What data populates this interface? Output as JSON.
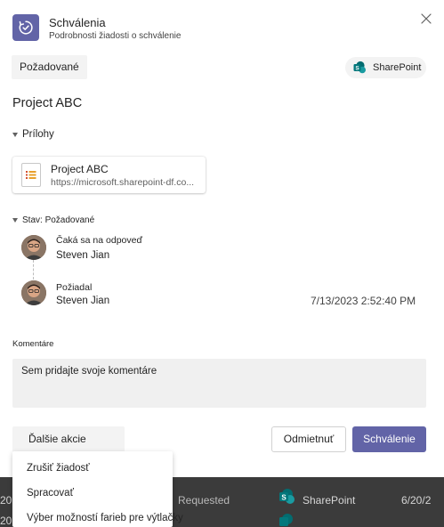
{
  "background": {
    "row1_left": "20",
    "row1_status": "Requested",
    "row1_source": "SharePoint",
    "row1_date": "6/20/2",
    "row2_left": "20"
  },
  "header": {
    "title": "Schválenia",
    "subtitle": "Podrobnosti žiadosti o schválenie",
    "app_icon": "approvals-icon",
    "close_icon": "close-icon"
  },
  "status_pill": "Požadované",
  "source_pill": "SharePoint",
  "project_title": "Project ABC",
  "attachments": {
    "section_label": "Prílohy",
    "item": {
      "name": "Project ABC",
      "url": "https://microsoft.sharepoint-df.co..."
    }
  },
  "status_section": {
    "label": "Stav: Požadované",
    "entries": [
      {
        "status": "Čaká sa na odpoveď",
        "name": "Steven Jian",
        "date": ""
      },
      {
        "status": "Požiadal",
        "name": "Steven Jian",
        "date": "7/13/2023 2:52:40 PM"
      }
    ]
  },
  "comments": {
    "label": "Komentáre",
    "placeholder": "Sem pridajte svoje komentáre"
  },
  "actions": {
    "more_label": "Ďalšie akcie",
    "decline_label": "Odmietnuť",
    "approve_label": "Schválenie"
  },
  "more_menu": [
    "Zrušiť žiadosť",
    "Spracovať",
    "Výber možností farieb pre výtlačky"
  ],
  "colors": {
    "accent": "#6264a7",
    "sharepoint": "#038387"
  }
}
